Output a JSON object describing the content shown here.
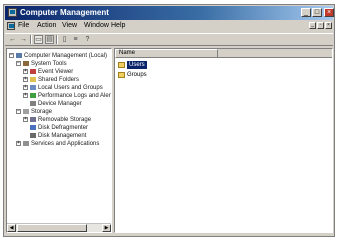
{
  "window": {
    "title": "Computer Management",
    "controls": {
      "minimize": "_",
      "maximize": "□",
      "close": "×"
    }
  },
  "menubar": {
    "items": [
      "File",
      "Action",
      "View",
      "Window",
      "Help"
    ],
    "mdi_controls": {
      "minimize": "_",
      "restore": "▫",
      "close": "×"
    }
  },
  "toolbar": {
    "buttons": [
      "back-icon",
      "forward-icon",
      "up-icon",
      "show-hide-tree-icon",
      "properties-icon",
      "export-list-icon",
      "help-icon"
    ],
    "glyphs": {
      "back": "←",
      "forward": "→",
      "up": "▭",
      "tree": "▤",
      "props": "▯",
      "export": "≡",
      "help": "?"
    }
  },
  "tree": {
    "items": [
      {
        "label": "Computer Management (Local)",
        "level": 0,
        "expander": "−",
        "icon": "computer-icon"
      },
      {
        "label": "System Tools",
        "level": 1,
        "expander": "−",
        "icon": "tools-icon"
      },
      {
        "label": "Event Viewer",
        "level": 2,
        "expander": "+",
        "icon": "event-viewer-icon"
      },
      {
        "label": "Shared Folders",
        "level": 2,
        "expander": "+",
        "icon": "shared-folder-icon"
      },
      {
        "label": "Local Users and Groups",
        "level": 2,
        "expander": "+",
        "icon": "users-icon"
      },
      {
        "label": "Performance Logs and Alerts",
        "level": 2,
        "expander": "+",
        "icon": "performance-icon"
      },
      {
        "label": "Device Manager",
        "level": 2,
        "expander": "",
        "icon": "device-manager-icon"
      },
      {
        "label": "Storage",
        "level": 1,
        "expander": "−",
        "icon": "storage-icon"
      },
      {
        "label": "Removable Storage",
        "level": 2,
        "expander": "+",
        "icon": "removable-storage-icon"
      },
      {
        "label": "Disk Defragmenter",
        "level": 2,
        "expander": "",
        "icon": "defrag-icon"
      },
      {
        "label": "Disk Management",
        "level": 2,
        "expander": "",
        "icon": "disk-management-icon"
      },
      {
        "label": "Services and Applications",
        "level": 1,
        "expander": "+",
        "icon": "services-icon"
      }
    ]
  },
  "scrollbar": {
    "left_arrow": "◀",
    "right_arrow": "▶"
  },
  "list": {
    "column_header": "Name",
    "items": [
      {
        "label": "Users",
        "selected": true
      },
      {
        "label": "Groups",
        "selected": false
      }
    ]
  },
  "colors": {
    "title_active": "#0a246a",
    "selection": "#0a246a",
    "folder": "#f0d060"
  }
}
